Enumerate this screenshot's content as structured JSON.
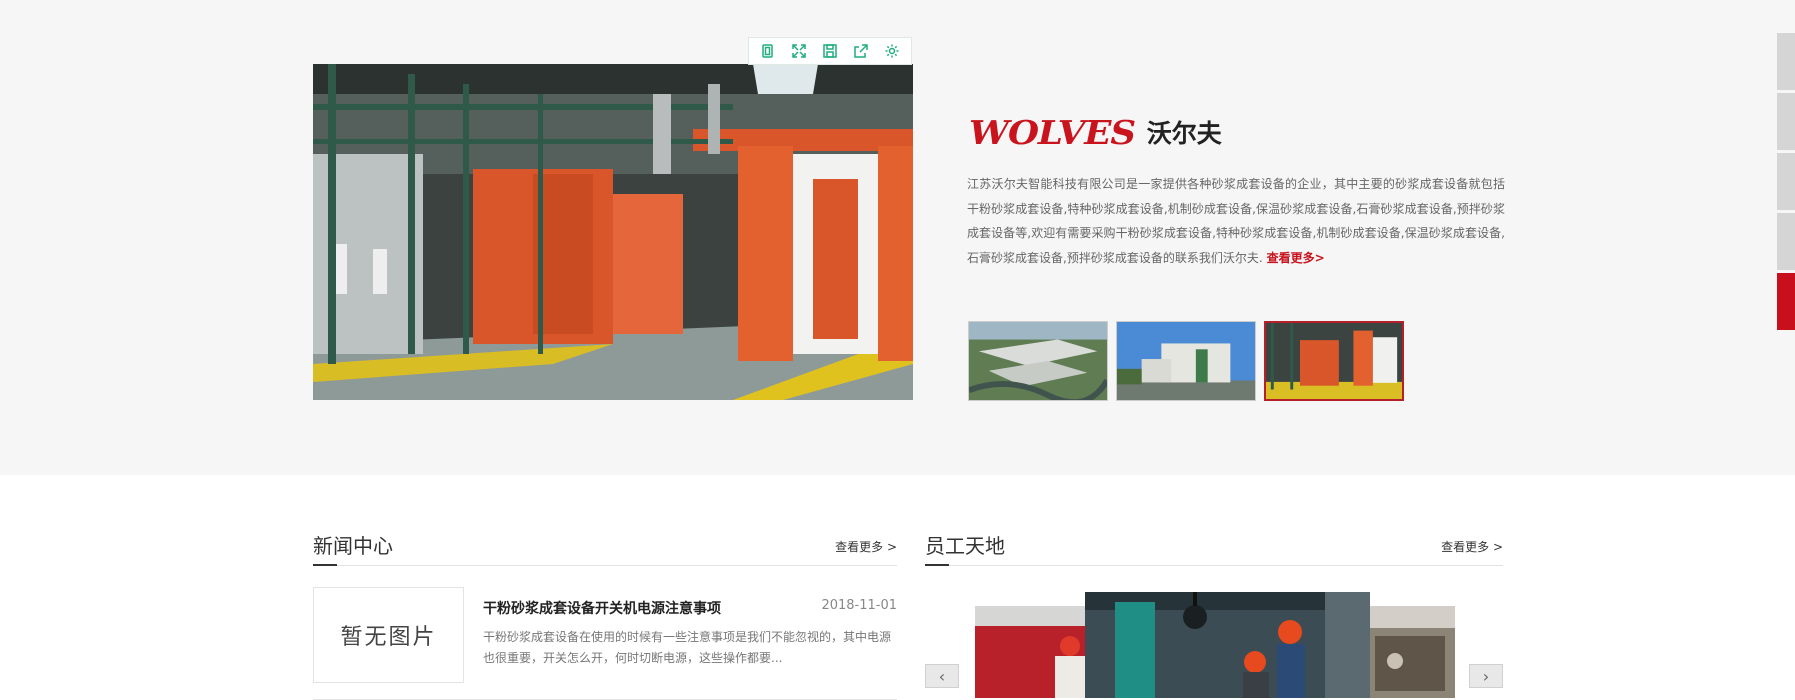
{
  "toolbar": {
    "icons": [
      "copy-icon",
      "fullscreen-icon",
      "save-icon",
      "share-icon",
      "settings-icon"
    ]
  },
  "brand": {
    "logo_text": "WOLVES",
    "name_cn": "沃尔夫"
  },
  "intro": {
    "text": "江苏沃尔夫智能科技有限公司是一家提供各种砂浆成套设备的企业，其中主要的砂浆成套设备就包括干粉砂浆成套设备,特种砂浆成套设备,机制砂成套设备,保温砂浆成套设备,石膏砂浆成套设备,预拌砂浆成套设备等,欢迎有需要采购干粉砂浆成套设备,特种砂浆成套设备,机制砂成套设备,保温砂浆成套设备,石膏砂浆成套设备,预拌砂浆成套设备的联系我们沃尔夫.",
    "more_label": "查看更多>"
  },
  "thumbnails": [
    {
      "name": "aerial-factory"
    },
    {
      "name": "office-building"
    },
    {
      "name": "spray-booth",
      "active": true
    }
  ],
  "side_tabs": 5,
  "news": {
    "title": "新闻中心",
    "more_label": "查看更多 >",
    "items": [
      {
        "image_placeholder": "暂无图片",
        "title": "干粉砂浆成套设备开关机电源注意事项",
        "date": "2018-11-01",
        "summary": "干粉砂浆成套设备在使用的时候有一些注意事项是我们不能忽视的，其中电源也很重要，开关怎么开，何时切断电源，这些操作都要..."
      }
    ]
  },
  "staff": {
    "title": "员工天地",
    "more_label": "查看更多 >"
  },
  "colors": {
    "accent": "#c9141e",
    "band": "#f6f6f7",
    "tool_green": "#1fae7d"
  }
}
